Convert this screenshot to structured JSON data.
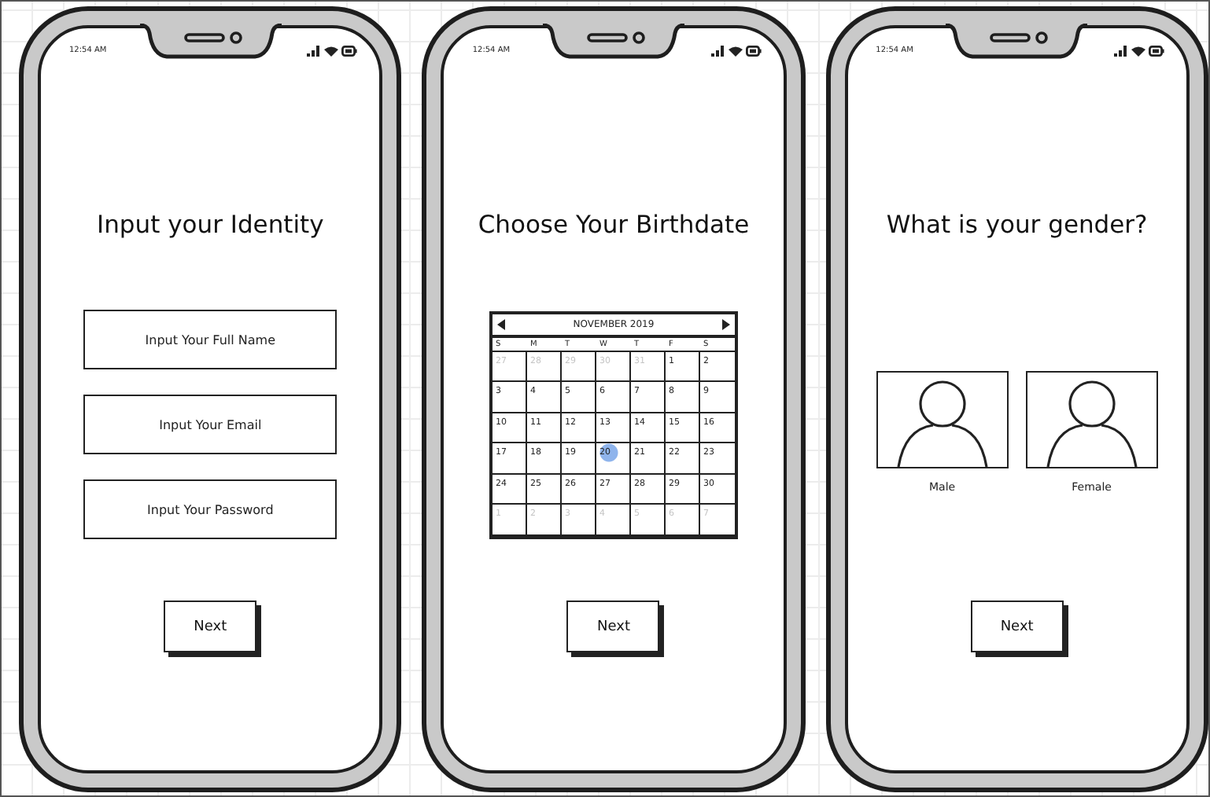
{
  "screens": [
    {
      "kind": "form",
      "status_time": "12:54 AM",
      "title": "Input your Identity",
      "fields": [
        {
          "placeholder": "Input Your Full Name"
        },
        {
          "placeholder": "Input Your Email"
        },
        {
          "placeholder": "Input Your Password"
        }
      ],
      "button": "Next"
    },
    {
      "kind": "calendar",
      "status_time": "12:54 AM",
      "title": "Choose Your Birthdate",
      "calendar": {
        "month": "NOVEMBER 2019",
        "weekdays": [
          "S",
          "M",
          "T",
          "W",
          "T",
          "F",
          "S"
        ],
        "days": [
          {
            "label": "27",
            "outside": true,
            "selected": false
          },
          {
            "label": "28",
            "outside": true,
            "selected": false
          },
          {
            "label": "29",
            "outside": true,
            "selected": false
          },
          {
            "label": "30",
            "outside": true,
            "selected": false
          },
          {
            "label": "31",
            "outside": true,
            "selected": false
          },
          {
            "label": "1",
            "outside": false,
            "selected": false
          },
          {
            "label": "2",
            "outside": false,
            "selected": false
          },
          {
            "label": "3",
            "outside": false,
            "selected": false
          },
          {
            "label": "4",
            "outside": false,
            "selected": false
          },
          {
            "label": "5",
            "outside": false,
            "selected": false
          },
          {
            "label": "6",
            "outside": false,
            "selected": false
          },
          {
            "label": "7",
            "outside": false,
            "selected": false
          },
          {
            "label": "8",
            "outside": false,
            "selected": false
          },
          {
            "label": "9",
            "outside": false,
            "selected": false
          },
          {
            "label": "10",
            "outside": false,
            "selected": false
          },
          {
            "label": "11",
            "outside": false,
            "selected": false
          },
          {
            "label": "12",
            "outside": false,
            "selected": false
          },
          {
            "label": "13",
            "outside": false,
            "selected": false
          },
          {
            "label": "14",
            "outside": false,
            "selected": false
          },
          {
            "label": "15",
            "outside": false,
            "selected": false
          },
          {
            "label": "16",
            "outside": false,
            "selected": false
          },
          {
            "label": "17",
            "outside": false,
            "selected": false
          },
          {
            "label": "18",
            "outside": false,
            "selected": false
          },
          {
            "label": "19",
            "outside": false,
            "selected": false
          },
          {
            "label": "20",
            "outside": false,
            "selected": true
          },
          {
            "label": "21",
            "outside": false,
            "selected": false
          },
          {
            "label": "22",
            "outside": false,
            "selected": false
          },
          {
            "label": "23",
            "outside": false,
            "selected": false
          },
          {
            "label": "24",
            "outside": false,
            "selected": false
          },
          {
            "label": "25",
            "outside": false,
            "selected": false
          },
          {
            "label": "26",
            "outside": false,
            "selected": false
          },
          {
            "label": "27",
            "outside": false,
            "selected": false
          },
          {
            "label": "28",
            "outside": false,
            "selected": false
          },
          {
            "label": "29",
            "outside": false,
            "selected": false
          },
          {
            "label": "30",
            "outside": false,
            "selected": false
          },
          {
            "label": "1",
            "outside": true,
            "selected": false
          },
          {
            "label": "2",
            "outside": true,
            "selected": false
          },
          {
            "label": "3",
            "outside": true,
            "selected": false
          },
          {
            "label": "4",
            "outside": true,
            "selected": false
          },
          {
            "label": "5",
            "outside": true,
            "selected": false
          },
          {
            "label": "6",
            "outside": true,
            "selected": false
          },
          {
            "label": "7",
            "outside": true,
            "selected": false
          }
        ]
      },
      "button": "Next"
    },
    {
      "kind": "choice",
      "status_time": "12:54 AM",
      "title": "What is your gender?",
      "options": [
        {
          "label": "Male",
          "selected": false
        },
        {
          "label": "Female",
          "selected": false
        }
      ],
      "button": "Next"
    }
  ]
}
